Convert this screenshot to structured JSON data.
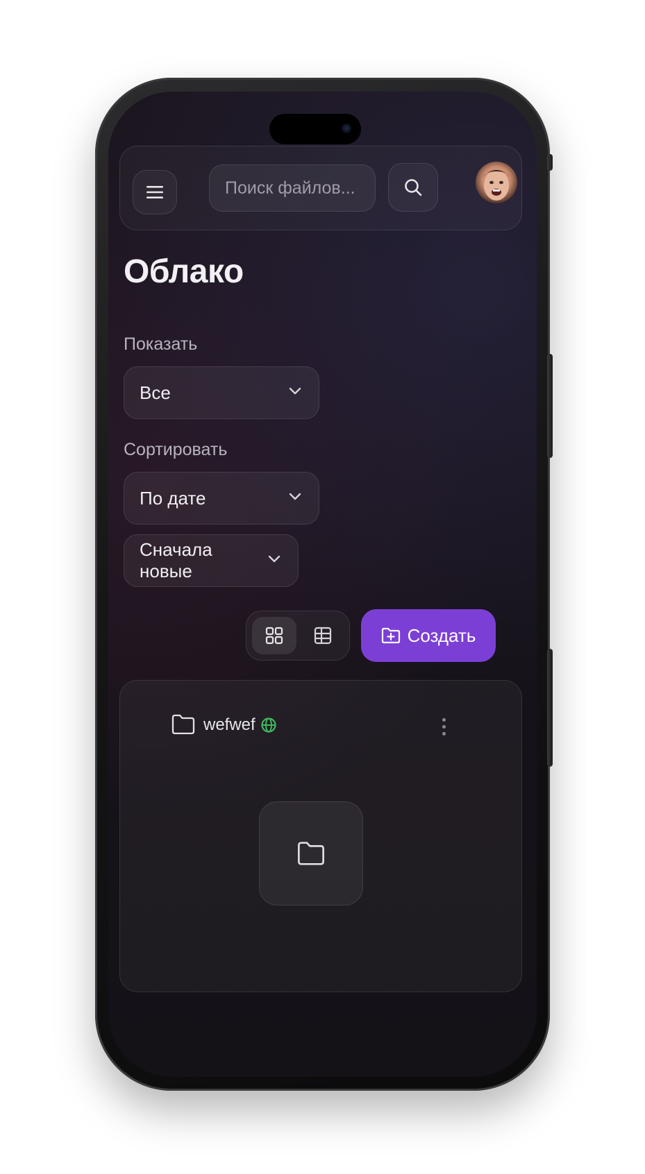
{
  "header": {
    "menu_icon": "hamburger-menu-icon",
    "search": {
      "placeholder": "Поиск файлов...",
      "value": ""
    },
    "search_icon": "search-icon",
    "avatar_icon": "user-avatar"
  },
  "page": {
    "title": "Облако"
  },
  "filters": {
    "show": {
      "label": "Показать",
      "value": "Все"
    },
    "sort": {
      "label": "Сортировать",
      "value": "По дате",
      "order": "Сначала новые"
    }
  },
  "toolbar": {
    "view_modes": [
      "grid-view-icon",
      "table-view-icon"
    ],
    "active_view": "grid",
    "create_label": "Создать",
    "create_icon": "folder-plus-icon"
  },
  "files": [
    {
      "name": "wefwef",
      "type": "folder",
      "public": true,
      "public_icon": "globe-icon"
    }
  ],
  "colors": {
    "accent": "#7c3fd6",
    "background": "#17131b",
    "public_badge": "#3dba5f"
  }
}
